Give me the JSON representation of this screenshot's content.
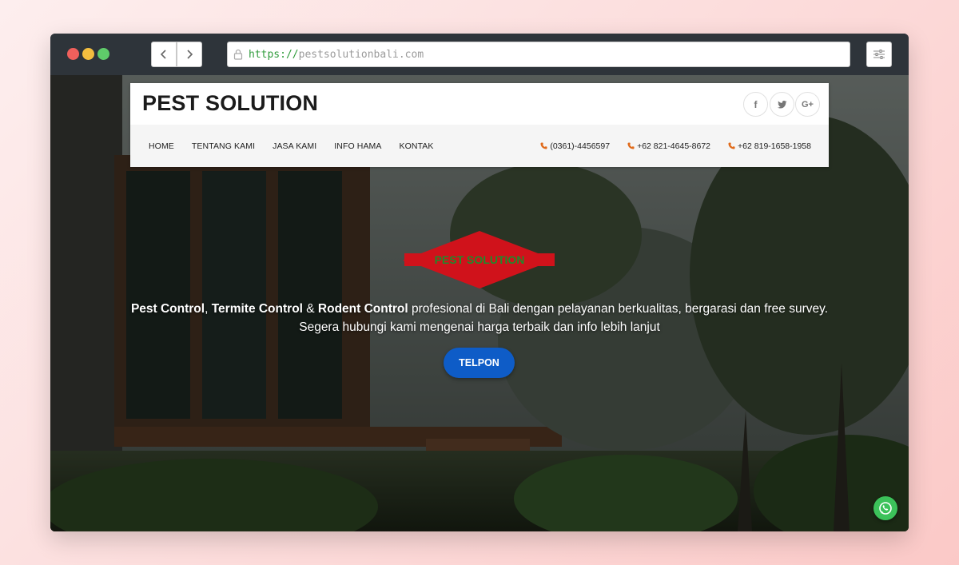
{
  "browser": {
    "url_scheme": "https://",
    "url_host": "pestsolutionbali.com"
  },
  "site": {
    "brand": "PEST SOLUTION",
    "nav": [
      "HOME",
      "TENTANG KAMI",
      "JASA KAMI",
      "INFO HAMA",
      "KONTAK"
    ],
    "phones": [
      "(0361)-4456597",
      "+62 821-4645-8672",
      "+62 819-1658-1958"
    ],
    "social": [
      "f",
      "t",
      "G+"
    ]
  },
  "hero": {
    "logo_text": "PEST SOLUTION",
    "tagline_bold_1": "Pest Control",
    "tagline_sep_1": ", ",
    "tagline_bold_2": "Termite Control",
    "tagline_sep_2": " & ",
    "tagline_bold_3": "Rodent Control",
    "tagline_rest": " profesional di Bali dengan pelayanan berkualitas, bergarasi dan free survey. Segera hubungi kami mengenai harga terbaik dan info lebih lanjut",
    "cta_label": "TELPON"
  },
  "colors": {
    "accent_blue": "#0e5cc7",
    "logo_red": "#d0121b",
    "logo_green": "#1f8a2c",
    "whatsapp_green": "#3cc25a",
    "phone_icon_orange": "#e06a1a"
  }
}
